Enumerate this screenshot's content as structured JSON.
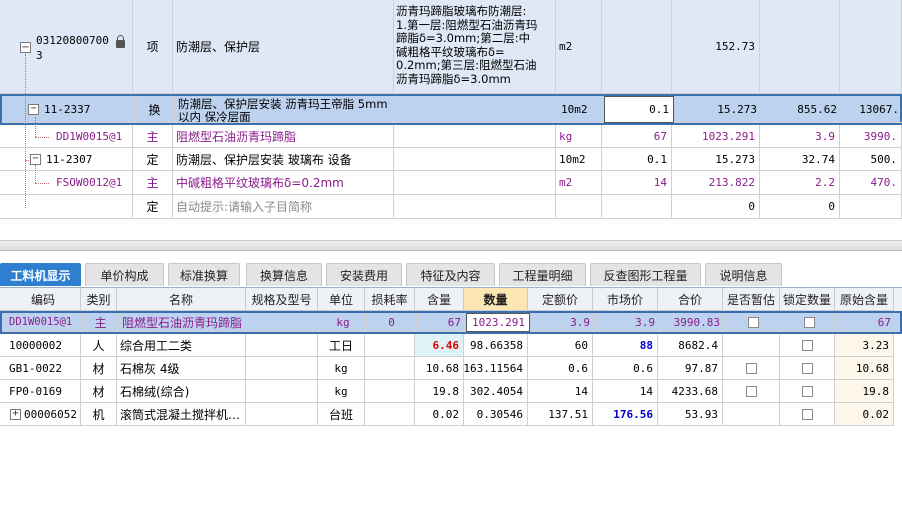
{
  "top_rows": [
    {
      "code_line1": "03120800700",
      "code_line2": "3",
      "category": "项",
      "name": "防潮层、保护层",
      "spec_lines": [
        "沥青玛蹄脂玻璃布防潮层:",
        "1.第一层:阻燃型石油沥青玛",
        "蹄脂δ=3.0mm;第二层:中",
        "碱粗格平纹玻璃布δ=",
        "0.2mm;第三层:阻燃型石油",
        "沥青玛蹄脂δ=3.0mm"
      ],
      "unit": "m2",
      "qty": "",
      "amount": "152.73",
      "price": "",
      "total": ""
    },
    {
      "code": "11-2337",
      "category": "换",
      "name_line1": "防潮层、保护层安装 沥青玛王帝脂 5mm",
      "name_line2": "以内 保冷层面",
      "unit": "10m2",
      "qty": "0.1",
      "amount": "15.273",
      "price": "855.62",
      "total": "13067."
    },
    {
      "code": "DD1W0015@1",
      "category": "主",
      "name": "阻燃型石油沥青玛蹄脂",
      "unit": "kg",
      "qty": "67",
      "amount": "1023.291",
      "price": "3.9",
      "total": "3990."
    },
    {
      "code": "11-2307",
      "category": "定",
      "name": "防潮层、保护层安装 玻璃布 设备",
      "unit": "10m2",
      "qty": "0.1",
      "amount": "15.273",
      "price": "32.74",
      "total": "500."
    },
    {
      "code": "FSOW0012@1",
      "category": "主",
      "name": "中碱粗格平纹玻璃布δ=0.2mm",
      "unit": "m2",
      "qty": "14",
      "amount": "213.822",
      "price": "2.2",
      "total": "470."
    },
    {
      "code": "",
      "category": "定",
      "name": "自动提示:请输入子目简称",
      "unit": "",
      "qty": "",
      "amount": "0",
      "price": "0",
      "total": ""
    }
  ],
  "tabs": [
    "工料机显示",
    "单价构成",
    "标准换算",
    "换算信息",
    "安装费用",
    "特征及内容",
    "工程量明细",
    "反查图形工程量",
    "说明信息"
  ],
  "bottom_headers": [
    "编码",
    "类别",
    "名称",
    "规格及型号",
    "单位",
    "损耗率",
    "含量",
    "数量",
    "定额价",
    "市场价",
    "合价",
    "是否暂估",
    "锁定数量",
    "原始含量"
  ],
  "bottom_rows": [
    {
      "code": "DD1W0015@1",
      "cat": "主",
      "name": "阻燃型石油沥青玛蹄脂",
      "spec": "",
      "unit": "kg",
      "loss": "0",
      "content": "67",
      "qty": "1023.291",
      "quota": "3.9",
      "market": "3.9",
      "total": "3990.83",
      "orig": "67"
    },
    {
      "code": "10000002",
      "cat": "人",
      "name": "综合用工二类",
      "spec": "",
      "unit": "工日",
      "loss": "",
      "content": "6.46",
      "qty": "98.66358",
      "quota": "60",
      "market": "88",
      "total": "8682.4",
      "orig": "3.23"
    },
    {
      "code": "GB1-0022",
      "cat": "材",
      "name": "石棉灰 4级",
      "spec": "",
      "unit": "kg",
      "loss": "",
      "content": "10.68",
      "qty": "163.11564",
      "quota": "0.6",
      "market": "0.6",
      "total": "97.87",
      "orig": "10.68"
    },
    {
      "code": "FP0-0169",
      "cat": "材",
      "name": "石棉绒(综合)",
      "spec": "",
      "unit": "kg",
      "loss": "",
      "content": "19.8",
      "qty": "302.4054",
      "quota": "14",
      "market": "14",
      "total": "4233.68",
      "orig": "19.8"
    },
    {
      "code": "00006052",
      "cat": "机",
      "name": "滚筒式混凝土搅拌机…",
      "spec": "",
      "unit": "台班",
      "loss": "",
      "content": "0.02",
      "qty": "0.30546",
      "quota": "137.51",
      "market": "176.56",
      "total": "53.93",
      "orig": "0.02"
    }
  ],
  "icons": {
    "lock": "lock-icon",
    "collapse": "minus-icon",
    "expand": "plus-icon"
  },
  "colors": {
    "selected_row": "#bcd2ee",
    "tab_active": "#2f7fd0",
    "purple_text": "#8b1c8b",
    "red_value": "#e00000",
    "blue_value": "#0000cc"
  }
}
